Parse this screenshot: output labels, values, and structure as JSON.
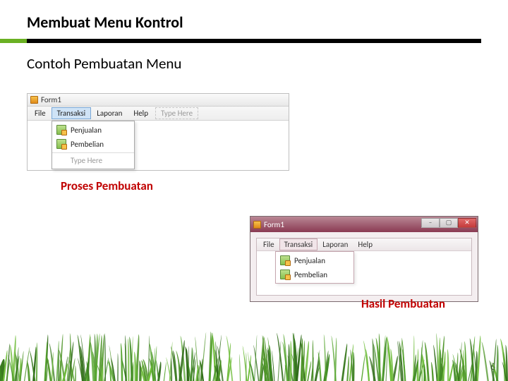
{
  "slide": {
    "title": "Membuat Menu Kontrol",
    "section_heading": "Contoh Pembuatan Menu",
    "page_number": "6",
    "caption_process": "Proses Pembuatan",
    "caption_result": "Hasil Pembuatan"
  },
  "editor_window": {
    "title": "Form1",
    "menubar": {
      "items": [
        "File",
        "Transaksi",
        "Laporan",
        "Help"
      ],
      "selected_index": 1,
      "type_here_placeholder": "Type Here"
    },
    "dropdown": {
      "items": [
        "Penjualan",
        "Pembelian"
      ],
      "type_here_placeholder": "Type Here"
    }
  },
  "runtime_window": {
    "title": "Form1",
    "menubar": {
      "items": [
        "File",
        "Transaksi",
        "Laporan",
        "Help"
      ],
      "open_index": 1
    },
    "dropdown": {
      "items": [
        "Penjualan",
        "Pembelian"
      ]
    },
    "window_buttons": {
      "minimize": "–",
      "maximize": "▢",
      "close": "✕"
    }
  }
}
